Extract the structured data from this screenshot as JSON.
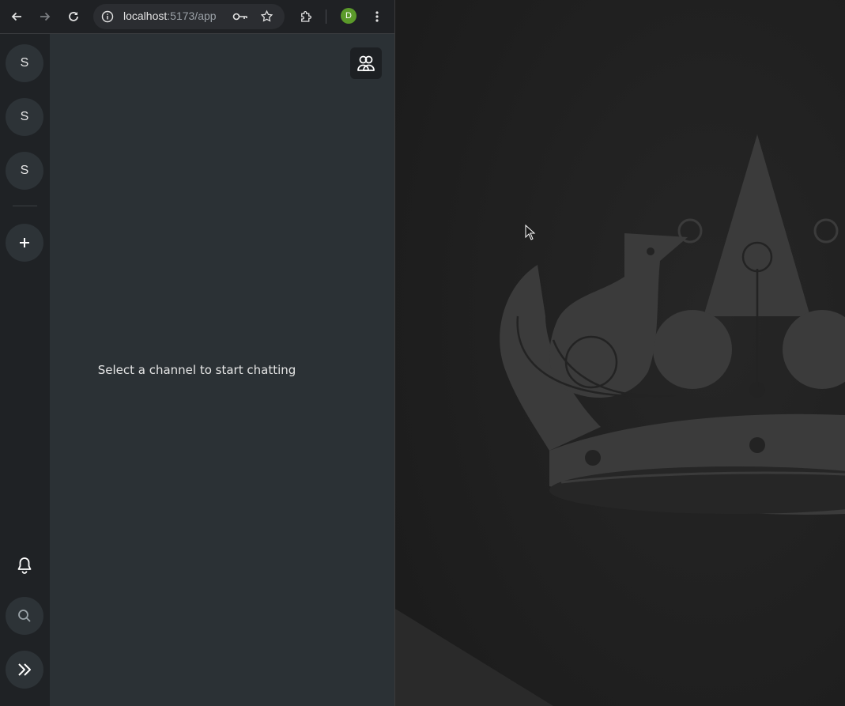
{
  "browser": {
    "url_host": "localhost",
    "url_path": ":5173/app",
    "profile_initial": "D"
  },
  "rail": {
    "servers": [
      {
        "initial": "S"
      },
      {
        "initial": "S"
      },
      {
        "initial": "S"
      }
    ],
    "add_label": "+"
  },
  "main": {
    "empty_message": "Select a channel to start chatting"
  },
  "icons": {
    "back": "back-arrow-icon",
    "forward": "forward-arrow-icon",
    "reload": "reload-icon",
    "site_info": "info-icon",
    "password": "key-icon",
    "bookmark": "star-icon",
    "extensions": "puzzle-icon",
    "menu": "kebab-menu-icon",
    "members": "users-icon",
    "notifications": "bell-icon",
    "search": "search-icon",
    "expand": "double-chevron-right-icon"
  },
  "colors": {
    "rail_bg": "#1f2225",
    "main_bg": "#2b3135",
    "server_bg": "#2d3337",
    "wallpaper_bg": "#222222",
    "profile_accent": "#5b9a2a"
  }
}
